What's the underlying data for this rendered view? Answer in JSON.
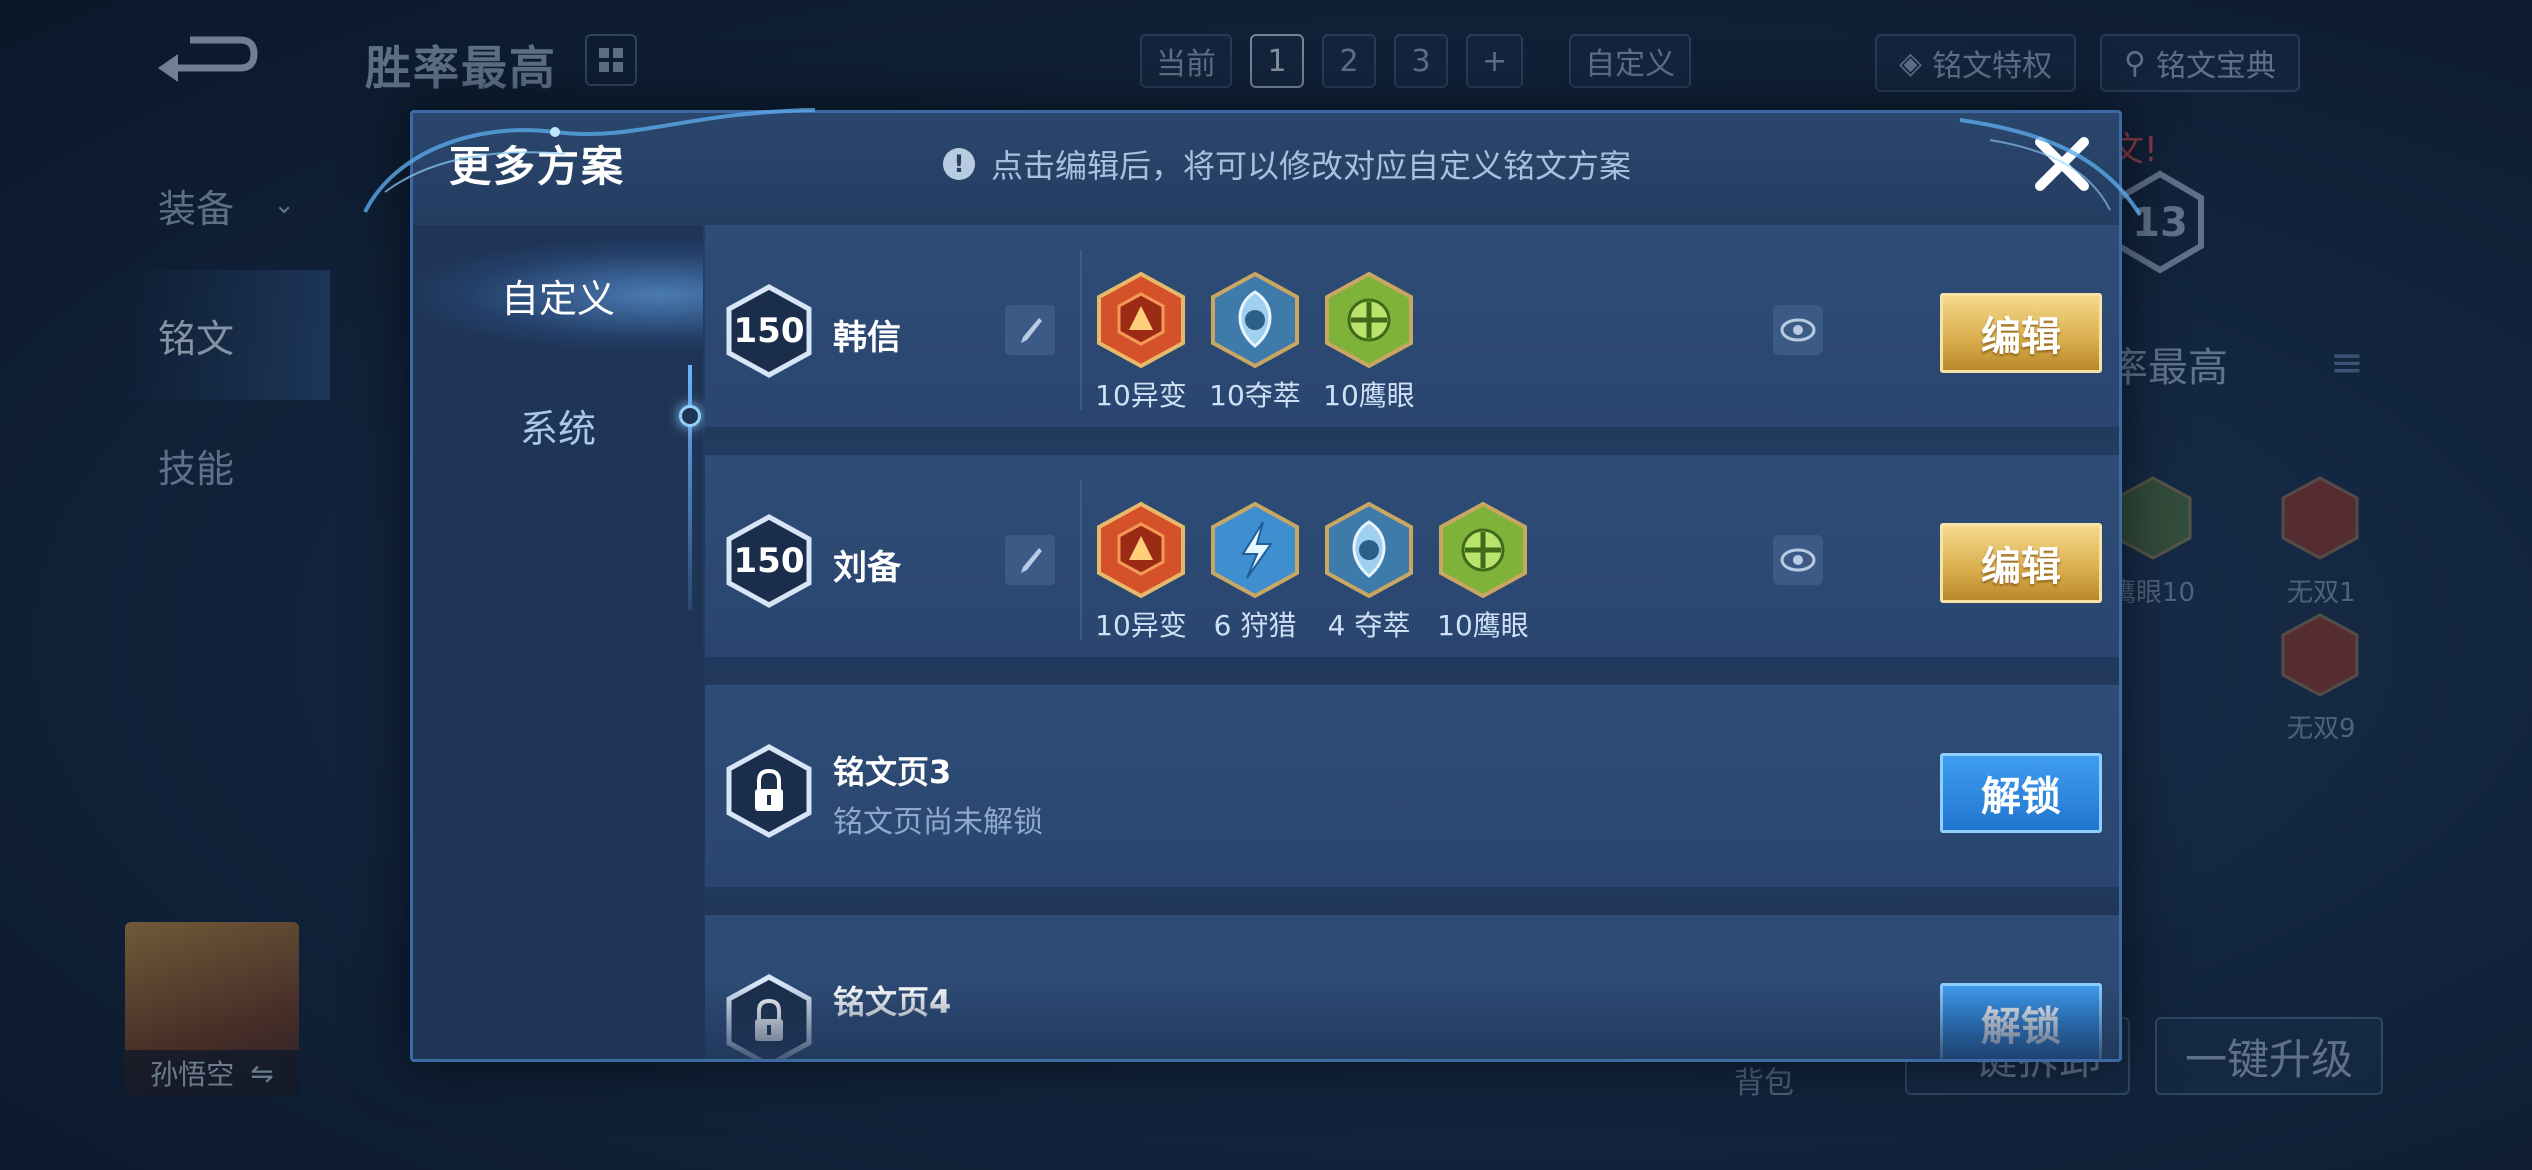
{
  "background": {
    "title": "胜率最高",
    "tabs": [
      "当前",
      "1",
      "2",
      "3",
      "+"
    ],
    "active_tab": "1",
    "custom_label": "自定义",
    "privilege_label": "铭文特权",
    "guide_label": "铭文宝典",
    "side_items": [
      "装备",
      "铭文",
      "技能"
    ],
    "hero_name": "孙悟空",
    "warn_text": "文!",
    "badge_number": "13",
    "right_title": "率最高",
    "rune_labels": [
      "鹰眼10",
      "无双1",
      "无双9"
    ],
    "bag_label": "背包",
    "bottom_left_btn": "一键拆卸",
    "bottom_right_btn": "一键升级"
  },
  "modal": {
    "title": "更多方案",
    "tip": "点击编辑后，将可以修改对应自定义铭文方案",
    "tip_icon": "!",
    "nav": [
      {
        "label": "自定义",
        "active": true
      },
      {
        "label": "系统",
        "active": false
      }
    ],
    "rows": [
      {
        "level": "150",
        "name": "韩信",
        "runes": [
          {
            "icon": "mutation-rune",
            "color": "#d4512a",
            "label": "10异变"
          },
          {
            "icon": "seize-rune",
            "color": "#4b8fc2",
            "label": "10夺萃"
          },
          {
            "icon": "hawkeye-rune",
            "color": "#7fb238",
            "label": "10鹰眼"
          }
        ],
        "action": "编辑"
      },
      {
        "level": "150",
        "name": "刘备",
        "runes": [
          {
            "icon": "mutation-rune",
            "color": "#d4512a",
            "label": "10异变"
          },
          {
            "icon": "hunt-rune",
            "color": "#3f8fd0",
            "label": "6 狩猎"
          },
          {
            "icon": "seize-rune",
            "color": "#4b8fc2",
            "label": "4 夺萃"
          },
          {
            "icon": "hawkeye-rune",
            "color": "#7fb238",
            "label": "10鹰眼"
          }
        ],
        "action": "编辑"
      },
      {
        "name": "铭文页3",
        "sub": "铭文页尚未解锁",
        "action": "解锁"
      },
      {
        "name": "铭文页4",
        "action": "解锁"
      }
    ]
  }
}
